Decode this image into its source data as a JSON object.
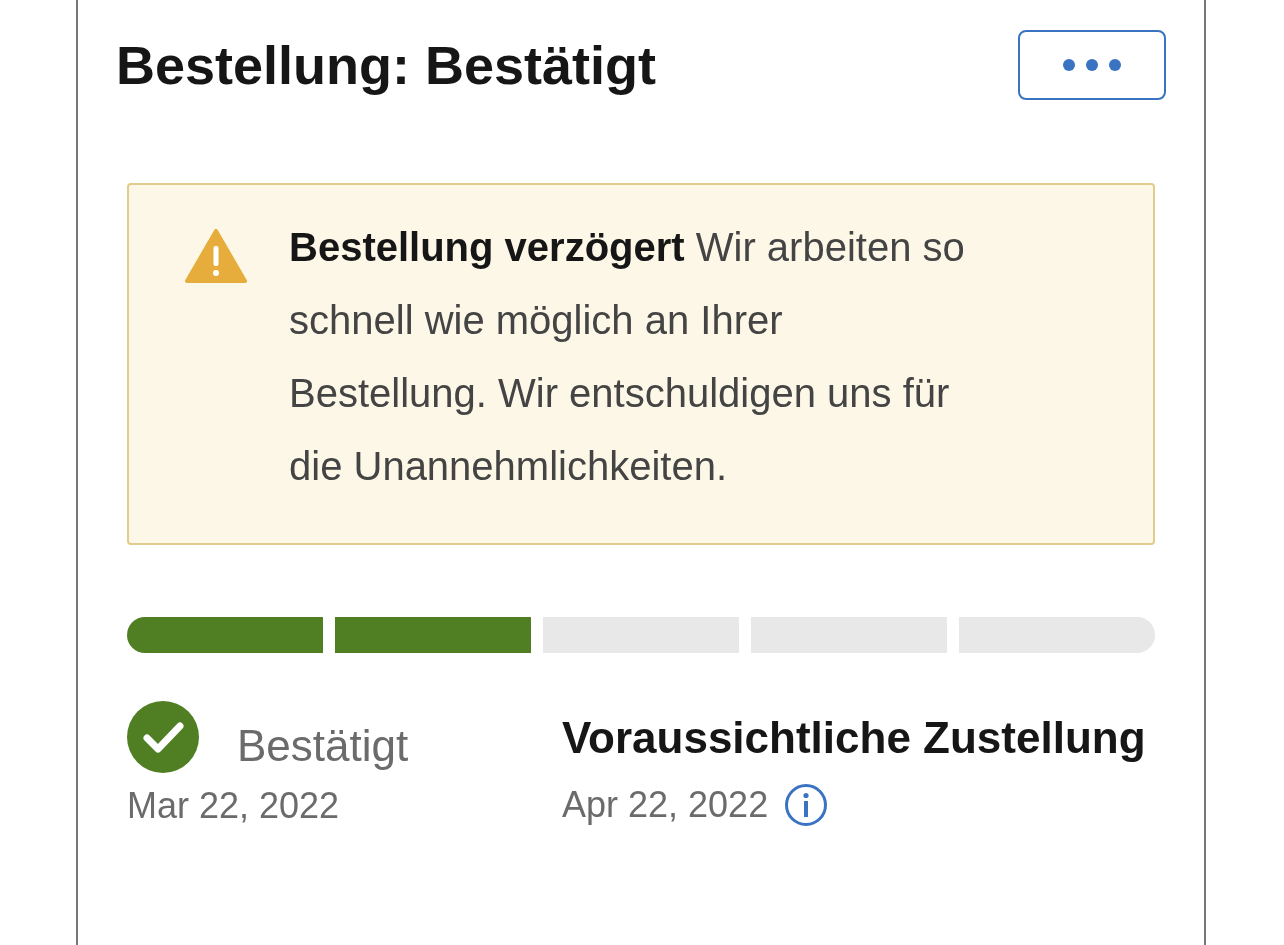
{
  "title": "Bestellung: Bestätigt",
  "alert": {
    "kind": "warning",
    "heading": "Bestellung verzögert",
    "message": "Wir arbeiten so schnell wie möglich an Ihrer Bestellung. Wir entschuldigen uns für die Unannehmlichkeiten."
  },
  "progress": [
    {
      "completed": true
    },
    {
      "completed": true
    },
    {
      "completed": false
    },
    {
      "completed": false
    },
    {
      "completed": false
    }
  ],
  "status": {
    "label": "Bestätigt",
    "date": "Mar 22, 2022",
    "completed": true
  },
  "delivery": {
    "label": "Voraussichtliche Zustellung",
    "date": "Apr 22, 2022"
  }
}
